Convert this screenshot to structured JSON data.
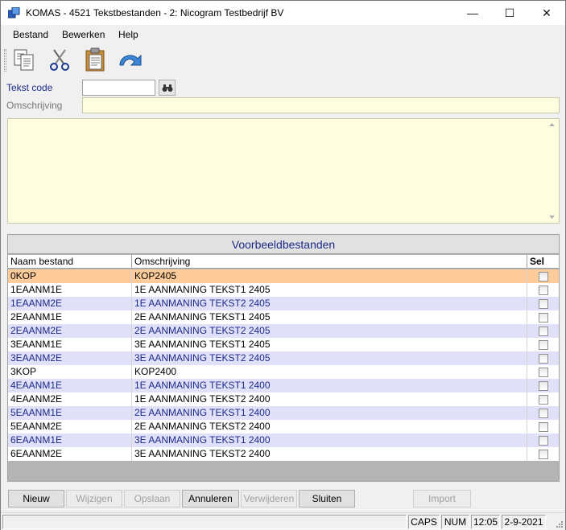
{
  "window": {
    "title": "KOMAS - 4521 Tekstbestanden - 2: Nicogram Testbedrijf BV",
    "minimize": "—",
    "maximize": "☐",
    "close": "✕"
  },
  "menu": [
    "Bestand",
    "Bewerken",
    "Help"
  ],
  "toolbar": {
    "icons": [
      "copy-icon",
      "cut-icon",
      "paste-icon",
      "undo-icon"
    ]
  },
  "form": {
    "tekst_code_label": "Tekst code",
    "tekst_code_value": "",
    "omschrijving_label": "Omschrijving",
    "omschrijving_value": "",
    "memo_value": ""
  },
  "grid": {
    "caption": "Voorbeeldbestanden",
    "columns": [
      "Naam bestand",
      "Omschrijving",
      "Sel"
    ],
    "rows": [
      {
        "name": "0KOP",
        "desc": "KOP2405",
        "sel": false
      },
      {
        "name": "1EAANM1E",
        "desc": "1E AANMANING TEKST1 2405",
        "sel": false
      },
      {
        "name": "1EAANM2E",
        "desc": "1E AANMANING TEKST2 2405",
        "sel": false
      },
      {
        "name": "2EAANM1E",
        "desc": "2E AANMANING TEKST1 2405",
        "sel": false
      },
      {
        "name": "2EAANM2E",
        "desc": "2E AANMANING TEKST2 2405",
        "sel": false
      },
      {
        "name": "3EAANM1E",
        "desc": "3E AANMANING TEKST1 2405",
        "sel": false
      },
      {
        "name": "3EAANM2E",
        "desc": "3E AANMANING TEKST2 2405",
        "sel": false
      },
      {
        "name": "3KOP",
        "desc": "KOP2400",
        "sel": false
      },
      {
        "name": "4EAANM1E",
        "desc": "1E AANMANING TEKST1 2400",
        "sel": false
      },
      {
        "name": "4EAANM2E",
        "desc": "1E AANMANING TEKST2 2400",
        "sel": false
      },
      {
        "name": "5EAANM1E",
        "desc": "2E AANMANING TEKST1 2400",
        "sel": false
      },
      {
        "name": "5EAANM2E",
        "desc": "2E AANMANING TEKST2 2400",
        "sel": false
      },
      {
        "name": "6EAANM1E",
        "desc": "3E AANMANING TEKST1 2400",
        "sel": false
      },
      {
        "name": "6EAANM2E",
        "desc": "3E AANMANING TEKST2 2400",
        "sel": false
      }
    ],
    "colors": {
      "selected": "#fdcc9a",
      "alt": "#e0e0f8",
      "normal": "#ffffff"
    }
  },
  "buttons": {
    "nieuw": "Nieuw",
    "wijzigen": "Wijzigen",
    "opslaan": "Opslaan",
    "annuleren": "Annuleren",
    "verwijderen": "Verwijderen",
    "sluiten": "Sluiten",
    "import": "Import"
  },
  "status": {
    "caps": "CAPS",
    "num": "NUM",
    "time": "12:05",
    "date": "2-9-2021"
  }
}
